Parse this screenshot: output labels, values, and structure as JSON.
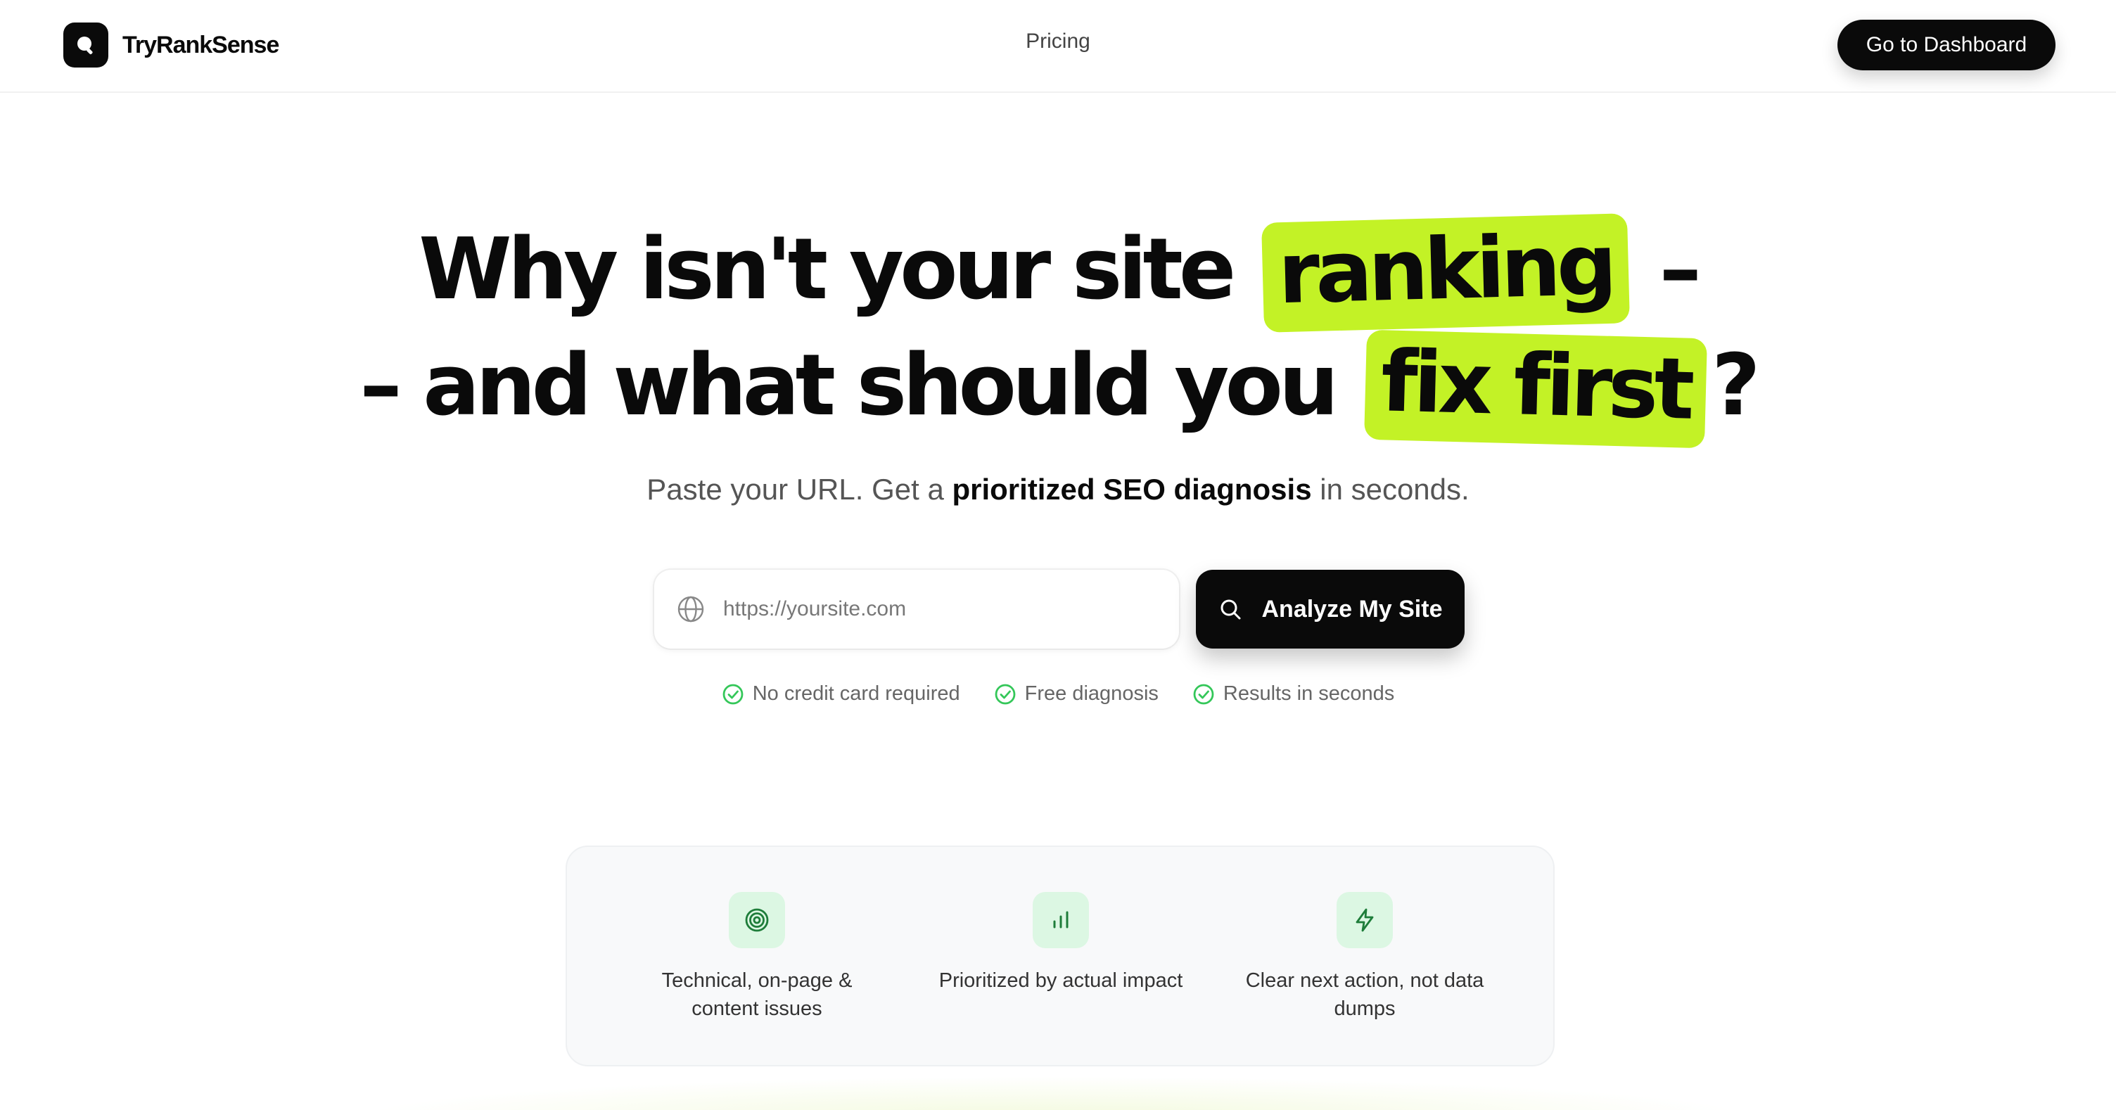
{
  "header": {
    "brand": "TryRankSense",
    "nav": {
      "pricing": "Pricing"
    },
    "dashboard_label": "Go to Dashboard"
  },
  "hero": {
    "line1_pre": "Why isn't your site",
    "line1_highlight": "ranking",
    "line1_post": "–",
    "line2_pre": "– and what should you",
    "line2_highlight": "fix first",
    "line2_post": "?",
    "sub_pre": "Paste your URL. Get a",
    "sub_bold": "prioritized SEO diagnosis",
    "sub_post": "in seconds."
  },
  "search": {
    "placeholder": "https://yoursite.com",
    "value": "",
    "button_label": "Analyze My Site"
  },
  "benefits": [
    "No credit card required",
    "Free diagnosis",
    "Results in seconds"
  ],
  "features": [
    {
      "icon": "target-icon",
      "text_line1": "Technical, on-page &",
      "text_line2": "content issues"
    },
    {
      "icon": "bar-chart-icon",
      "text_line1": "Prioritized by actual impact",
      "text_line2": ""
    },
    {
      "icon": "lightning-icon",
      "text_line1": "Clear next action, not data",
      "text_line2": "dumps"
    }
  ],
  "colors": {
    "accent_highlight": "#c3f226",
    "primary": "#0a0a0a",
    "check_green": "#34c759",
    "feature_icon_bg": "#dcf7e3",
    "feature_icon_fg": "#1e7d3a"
  }
}
